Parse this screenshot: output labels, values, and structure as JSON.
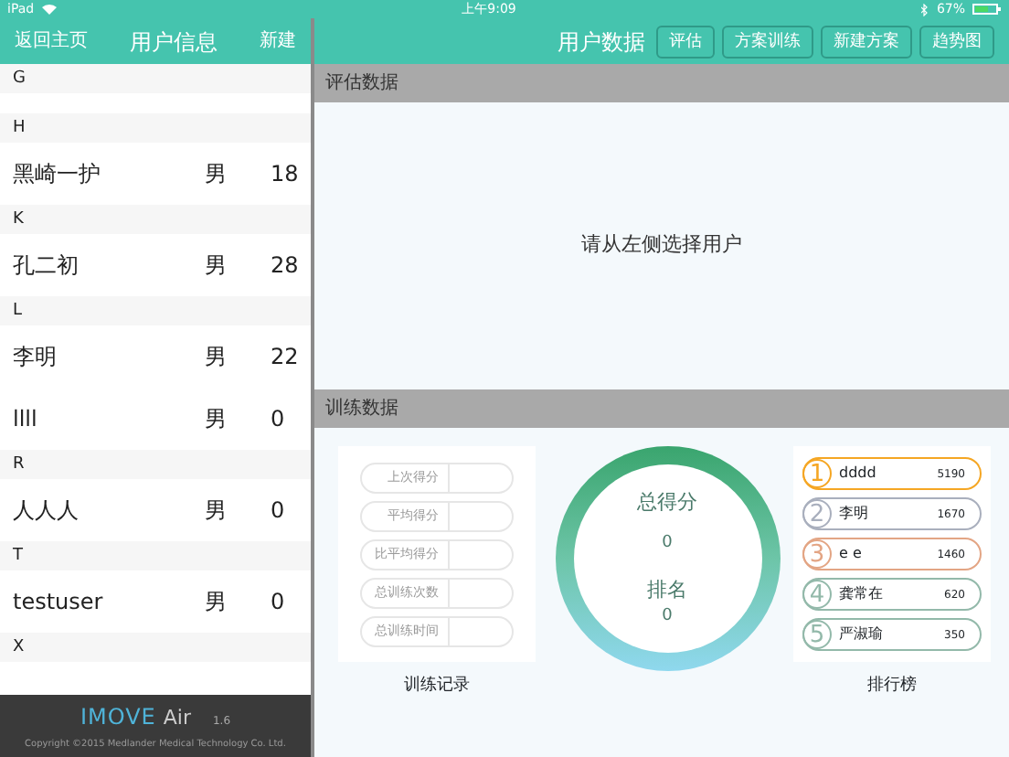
{
  "status_bar": {
    "device": "iPad",
    "time": "上午9:09",
    "battery": "67%"
  },
  "left_nav": {
    "back": "返回主页",
    "title": "用户信息",
    "new": "新建"
  },
  "user_list": [
    {
      "letter": "G"
    },
    {
      "letter": "H",
      "users": [
        {
          "name": "黑崎一护",
          "gender": "男",
          "age": "18"
        }
      ]
    },
    {
      "letter": "K",
      "users": [
        {
          "name": "孔二初",
          "gender": "男",
          "age": "28"
        }
      ]
    },
    {
      "letter": "L",
      "users": [
        {
          "name": "李明",
          "gender": "男",
          "age": "22"
        },
        {
          "name": "llll",
          "gender": "男",
          "age": "0"
        }
      ]
    },
    {
      "letter": "R",
      "users": [
        {
          "name": "人人人",
          "gender": "男",
          "age": "0"
        }
      ]
    },
    {
      "letter": "T",
      "users": [
        {
          "name": "testuser",
          "gender": "男",
          "age": "0"
        }
      ]
    },
    {
      "letter": "X"
    }
  ],
  "footer": {
    "logo": "IMOVE",
    "logo_suffix": "Air",
    "version": "1.6",
    "copyright": "Copyright ©2015 Medlander Medical Technology Co. Ltd."
  },
  "right_nav": {
    "title": "用户数据",
    "buttons": [
      "评估",
      "方案训练",
      "新建方案",
      "趋势图"
    ]
  },
  "assessment": {
    "heading": "评估数据",
    "message": "请从左侧选择用户"
  },
  "training": {
    "heading": "训练数据",
    "record_fields": [
      {
        "placeholder": "上次得分"
      },
      {
        "placeholder": "平均得分"
      },
      {
        "placeholder": "比平均得分"
      },
      {
        "placeholder": "总训练次数"
      },
      {
        "placeholder": "总训练时间"
      }
    ],
    "record_caption": "训练记录",
    "score_label": "总得分",
    "score": "0",
    "rank_label": "排名",
    "rank": "0",
    "ranking": [
      {
        "rank": "1",
        "name": "dddd",
        "score": "5190",
        "color": "#f5a623"
      },
      {
        "rank": "2",
        "name": "李明",
        "score": "1670",
        "color": "#a9afbd"
      },
      {
        "rank": "3",
        "name": "e e",
        "score": "1460",
        "color": "#e3a584"
      },
      {
        "rank": "4",
        "name": "龚常在",
        "score": "620",
        "color": "#93b9aa"
      },
      {
        "rank": "5",
        "name": "严淑瑜",
        "score": "350",
        "color": "#93b9aa"
      }
    ],
    "ranking_caption": "排行榜"
  }
}
